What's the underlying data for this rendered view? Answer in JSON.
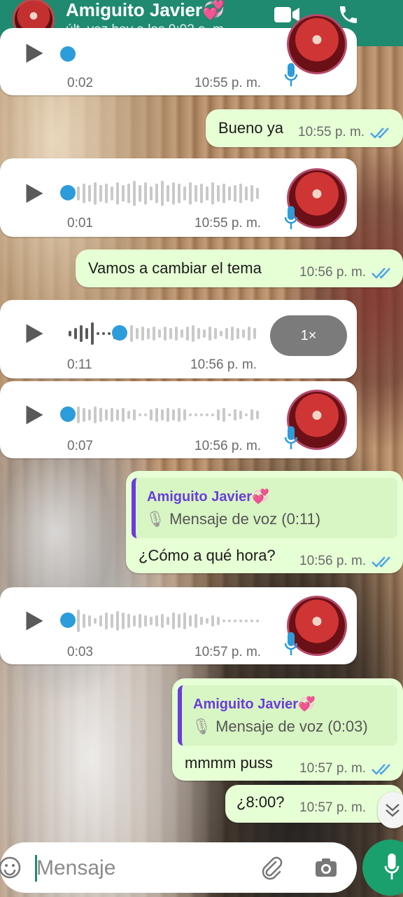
{
  "header": {
    "contact_name": "Amiguito Javier",
    "name_emoji": "💞",
    "last_seen": "últ. vez hoy a las 9:02 a. m."
  },
  "messages": [
    {
      "type": "voice_in",
      "duration": "0:02",
      "time": "10:55 p. m."
    },
    {
      "type": "text_out",
      "text": "Bueno ya",
      "time": "10:55 p. m."
    },
    {
      "type": "voice_in",
      "duration": "0:01",
      "time": "10:55 p. m."
    },
    {
      "type": "text_out",
      "text": "Vamos a cambiar el tema",
      "time": "10:56 p. m."
    },
    {
      "type": "voice_in_playing",
      "duration": "0:11",
      "time": "10:56 p. m.",
      "speed": "1×"
    },
    {
      "type": "voice_in",
      "duration": "0:07",
      "time": "10:56 p. m."
    },
    {
      "type": "reply_out",
      "quote_name": "Amiguito Javier",
      "quote_emoji": "💞",
      "quote_text": "Mensaje de voz (0:11)",
      "text": "¿Cómo a qué hora?",
      "time": "10:56 p. m."
    },
    {
      "type": "voice_in",
      "duration": "0:03",
      "time": "10:57 p. m."
    },
    {
      "type": "reply_out",
      "quote_name": "Amiguito Javier",
      "quote_emoji": "💞",
      "quote_text": "Mensaje de voz (0:03)",
      "text": "mmmm puss",
      "time": "10:57 p. m."
    },
    {
      "type": "text_out",
      "text": "¿8:00?",
      "time": "10:57 p. m."
    }
  ],
  "composer": {
    "placeholder": "Mensaje"
  },
  "colors": {
    "header": "#1f8a70",
    "outgoing_bubble": "#e6ffd5",
    "incoming_bubble": "#ffffff",
    "accent_blue": "#2c9cdb",
    "quote_purple": "#6a3ed8",
    "send_button": "#1aa06d"
  },
  "icons": [
    "video-call-icon",
    "phone-icon",
    "play-icon",
    "mic-icon",
    "double-check-icon",
    "emoji-icon",
    "attach-icon",
    "camera-icon",
    "scroll-down-icon"
  ]
}
